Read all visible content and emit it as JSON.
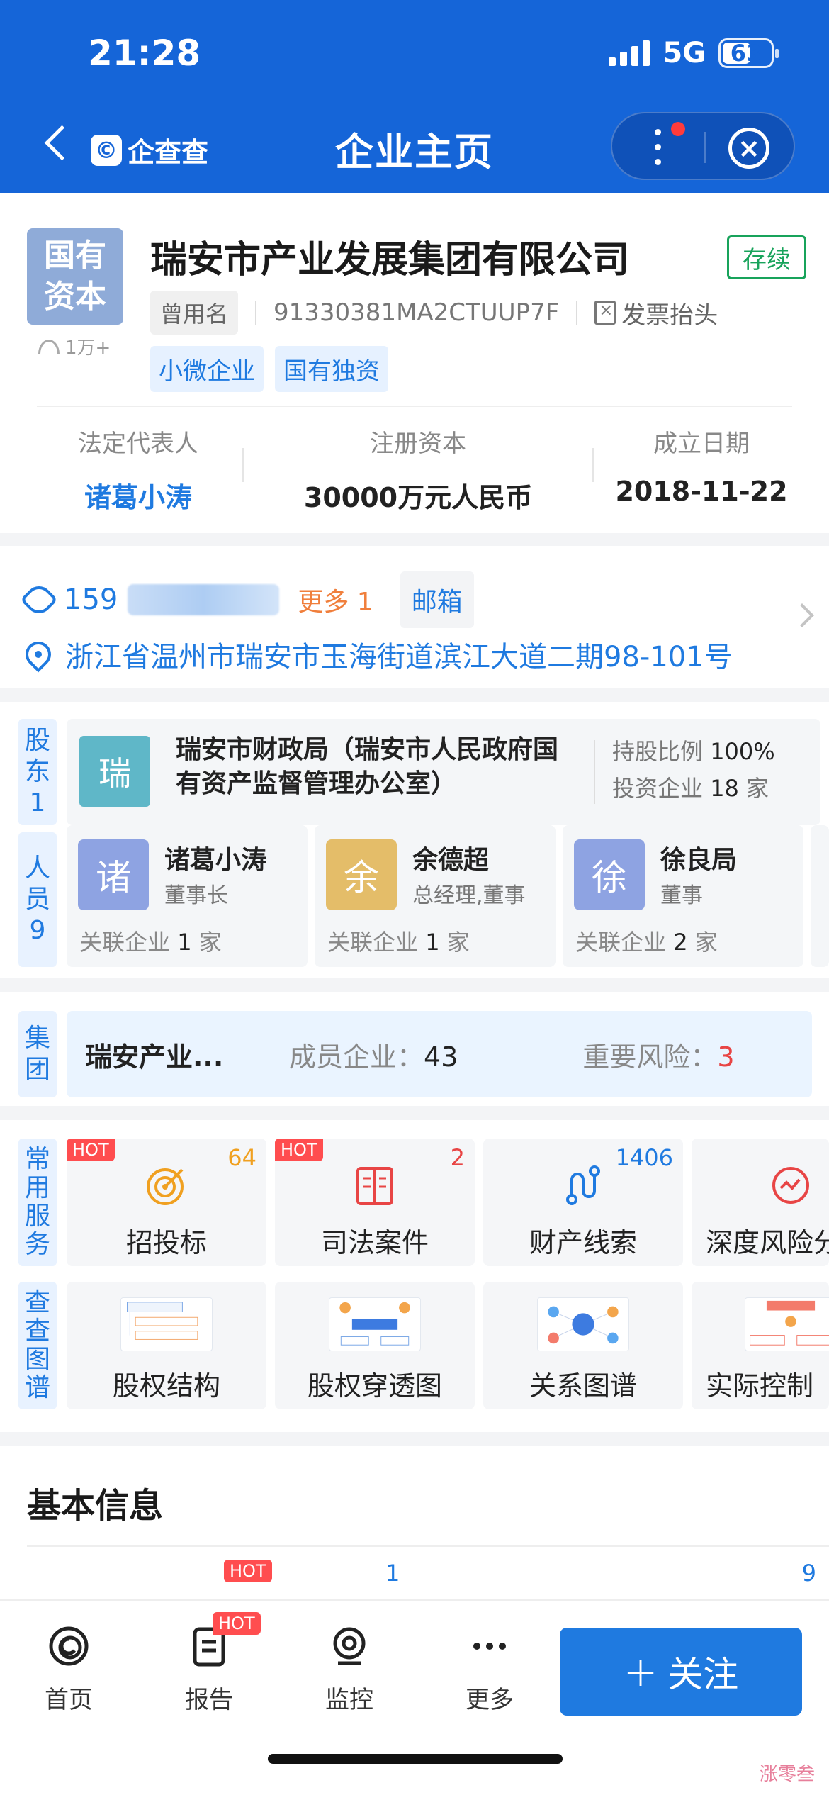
{
  "status_bar": {
    "time": "21:28",
    "network": "5G",
    "battery": "63",
    "battery_level_pct": 63
  },
  "nav": {
    "brand": "企查查",
    "title": "企业主页"
  },
  "company": {
    "logo_text_line1": "国有",
    "logo_text_line2": "资本",
    "views": "1万+",
    "name": "瑞安市产业发展集团有限公司",
    "status": "存续",
    "used_name_label": "曾用名",
    "credit_code": "91330381MA2CTUUP7F",
    "invoice_label": "发票抬头",
    "tags": [
      "小微企业",
      "国有独资"
    ],
    "legal_rep_label": "法定代表人",
    "legal_rep": "诸葛小涛",
    "reg_capital_label": "注册资本",
    "reg_capital": "30000万元人民币",
    "founded_label": "成立日期",
    "founded": "2018-11-22"
  },
  "contact": {
    "phone_prefix": "159",
    "more_phones": "更多 1",
    "email_label": "邮箱",
    "address": "浙江省温州市瑞安市玉海街道滨江大道二期98-101号"
  },
  "shareholders": {
    "side_label": [
      "股",
      "东",
      "1"
    ],
    "avatar_char": "瑞",
    "name": "瑞安市财政局（瑞安市人民政府国有资产监督管理办公室）",
    "ratio_label": "持股比例",
    "ratio": "100%",
    "invest_label": "投资企业",
    "invest_count": "18",
    "invest_unit": "家"
  },
  "personnel": {
    "side_label": [
      "人",
      "员",
      "9"
    ],
    "assoc_label": "关联企业",
    "unit": "家",
    "people": [
      {
        "char": "诸",
        "name": "诸葛小涛",
        "role": "董事长",
        "count": "1",
        "color": "#8ea3e2"
      },
      {
        "char": "余",
        "name": "余德超",
        "role": "总经理,董事",
        "count": "1",
        "color": "#e4bd69"
      },
      {
        "char": "徐",
        "name": "徐良局",
        "role": "董事",
        "count": "2",
        "color": "#8ea3e2"
      }
    ]
  },
  "group": {
    "side_label": [
      "集",
      "团"
    ],
    "name": "瑞安产业...",
    "members_label": "成员企业：",
    "members": "43",
    "risk_label": "重要风险：",
    "risk": "3"
  },
  "services": {
    "side_label_1": [
      "常",
      "用",
      "服",
      "务"
    ],
    "side_label_2": [
      "查",
      "查",
      "图",
      "谱"
    ],
    "hot_label": "HOT",
    "row1": [
      {
        "label": "招投标",
        "count": "64",
        "count_color": "#f0a020",
        "icon": "target-icon",
        "hot": true
      },
      {
        "label": "司法案件",
        "count": "2",
        "count_color": "#e84545",
        "icon": "book-icon",
        "hot": true
      },
      {
        "label": "财产线索",
        "count": "1406",
        "count_color": "#1f7ae0",
        "icon": "route-icon",
        "hot": false
      },
      {
        "label": "深度风险分",
        "count": "",
        "count_color": "#e84545",
        "icon": "risk-icon",
        "hot": false
      }
    ],
    "row2": [
      {
        "label": "股权结构",
        "icon": "equity-structure-diagram"
      },
      {
        "label": "股权穿透图",
        "icon": "equity-penetration-diagram"
      },
      {
        "label": "关系图谱",
        "icon": "relationship-graph-diagram"
      },
      {
        "label": "实际控制",
        "icon": "actual-control-diagram"
      }
    ]
  },
  "basic_info": {
    "title": "基本信息",
    "hot_label": "HOT",
    "count_1": "1",
    "count_2": "9"
  },
  "bottom_bar": {
    "tabs": [
      "首页",
      "报告",
      "监控",
      "更多"
    ],
    "report_hot": "HOT",
    "follow_label": "关注",
    "follow_plus": "+"
  },
  "watermark": "涨零叁"
}
